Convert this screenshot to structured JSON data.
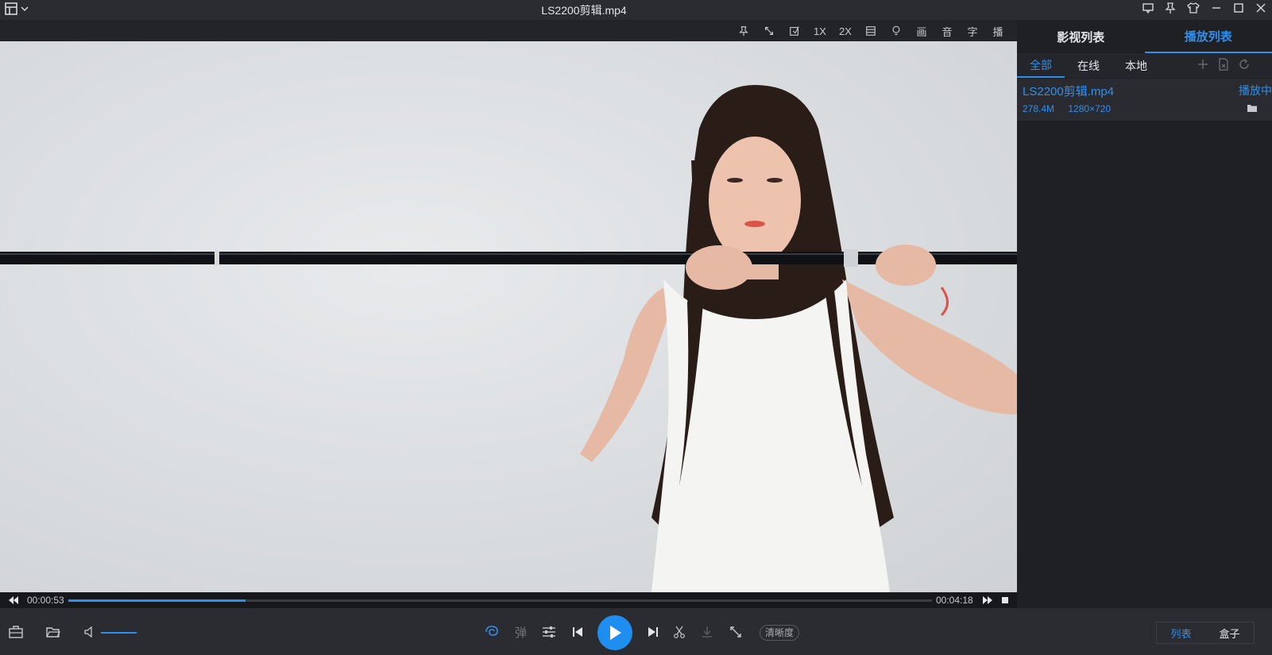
{
  "window": {
    "title": "LS2200剪辑.mp4"
  },
  "titlebar_icons": [
    "layout-menu-icon",
    "chevron-down-icon",
    "message-icon",
    "pin-icon",
    "skin-shirt-icon",
    "minimize-icon",
    "maximize-icon",
    "close-icon"
  ],
  "player_toolbar": {
    "items": [
      "1X",
      "2X",
      "画",
      "音",
      "字",
      "播"
    ]
  },
  "seek": {
    "current": "00:00:53",
    "total": "00:04:18",
    "progress": 0.205
  },
  "volume": {
    "level": 0.95
  },
  "controls": {
    "danmaku_label": "弹",
    "quality_label": "清晰度"
  },
  "bottom_tabs": {
    "list": "列表",
    "box": "盒子"
  },
  "sidepanel": {
    "tabs": [
      "影视列表",
      "播放列表"
    ],
    "active_tab": 1,
    "subtabs": [
      "全部",
      "在线",
      "本地"
    ],
    "active_subtab": 0,
    "playlist": [
      {
        "name": "LS2200剪辑.mp4",
        "status": "播放中",
        "size": "278.4M",
        "resolution": "1280×720"
      }
    ]
  },
  "colors": {
    "accent": "#2f8fee",
    "background": "#1f2024",
    "panel": "#2b2c31"
  }
}
